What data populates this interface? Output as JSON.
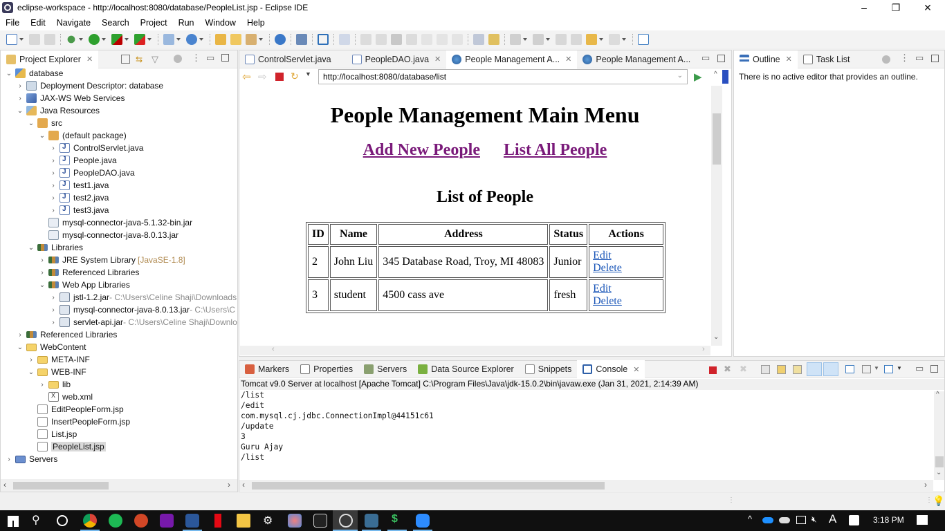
{
  "window": {
    "title": "eclipse-workspace - http://localhost:8080/database/PeopleList.jsp - Eclipse IDE",
    "minimize": "–",
    "restore": "❐",
    "close": "✕"
  },
  "menu": [
    "File",
    "Edit",
    "Navigate",
    "Search",
    "Project",
    "Run",
    "Window",
    "Help"
  ],
  "project_explorer": {
    "title": "Project Explorer",
    "tree": [
      {
        "label": "database",
        "twisty": "open",
        "icon": "project-icon",
        "depth": 0
      },
      {
        "label": "Deployment Descriptor: database",
        "twisty": "closed",
        "icon": "deployment-descriptor-icon",
        "depth": 1
      },
      {
        "label": "JAX-WS Web Services",
        "twisty": "closed",
        "icon": "web-services-icon",
        "depth": 1
      },
      {
        "label": "Java Resources",
        "twisty": "open",
        "icon": "java-resources-icon",
        "depth": 1
      },
      {
        "label": "src",
        "twisty": "open",
        "icon": "source-folder-icon",
        "depth": 2
      },
      {
        "label": "(default package)",
        "twisty": "open",
        "icon": "package-icon",
        "depth": 3
      },
      {
        "label": "ControlServlet.java",
        "twisty": "closed",
        "icon": "java-file-icon",
        "depth": 4
      },
      {
        "label": "People.java",
        "twisty": "closed",
        "icon": "java-file-icon",
        "depth": 4
      },
      {
        "label": "PeopleDAO.java",
        "twisty": "closed",
        "icon": "java-file-icon",
        "depth": 4
      },
      {
        "label": "test1.java",
        "twisty": "closed",
        "icon": "java-file-icon",
        "depth": 4
      },
      {
        "label": "test2.java",
        "twisty": "closed",
        "icon": "java-file-icon",
        "depth": 4
      },
      {
        "label": "test3.java",
        "twisty": "closed",
        "icon": "java-file-icon",
        "depth": 4
      },
      {
        "label": "mysql-connector-java-5.1.32-bin.jar",
        "twisty": "none",
        "icon": "jar-file-icon",
        "depth": 3
      },
      {
        "label": "mysql-connector-java-8.0.13.jar",
        "twisty": "none",
        "icon": "jar-file-icon",
        "depth": 3
      },
      {
        "label": "Libraries",
        "twisty": "open",
        "icon": "library-icon",
        "depth": 2
      },
      {
        "label": "JRE System Library",
        "decoration": "[JavaSE-1.8]",
        "twisty": "closed",
        "icon": "library-icon",
        "depth": 3
      },
      {
        "label": "Referenced Libraries",
        "twisty": "closed",
        "icon": "library-icon",
        "depth": 3
      },
      {
        "label": "Web App Libraries",
        "twisty": "open",
        "icon": "library-icon",
        "depth": 3
      },
      {
        "label": "jstl-1.2.jar",
        "decoration": " - C:\\Users\\Celine Shaji\\Downloads",
        "twisty": "closed",
        "icon": "jar-archive-icon",
        "depth": 4
      },
      {
        "label": "mysql-connector-java-8.0.13.jar",
        "decoration": " - C:\\Users\\C",
        "twisty": "closed",
        "icon": "jar-archive-icon",
        "depth": 4
      },
      {
        "label": "servlet-api.jar",
        "decoration": " - C:\\Users\\Celine Shaji\\Downlo",
        "twisty": "closed",
        "icon": "jar-archive-icon",
        "depth": 4
      },
      {
        "label": "Referenced Libraries",
        "twisty": "closed",
        "icon": "library-icon",
        "depth": 1
      },
      {
        "label": "WebContent",
        "twisty": "open",
        "icon": "folder-icon",
        "depth": 1
      },
      {
        "label": "META-INF",
        "twisty": "closed",
        "icon": "folder-icon",
        "depth": 2
      },
      {
        "label": "WEB-INF",
        "twisty": "open",
        "icon": "folder-icon",
        "depth": 2
      },
      {
        "label": "lib",
        "twisty": "closed",
        "icon": "folder-icon",
        "depth": 3
      },
      {
        "label": "web.xml",
        "twisty": "none",
        "icon": "xml-file-icon",
        "depth": 3
      },
      {
        "label": "EditPeopleForm.jsp",
        "twisty": "none",
        "icon": "jsp-file-icon",
        "depth": 2
      },
      {
        "label": "InsertPeopleForm.jsp",
        "twisty": "none",
        "icon": "jsp-file-icon",
        "depth": 2
      },
      {
        "label": "List.jsp",
        "twisty": "none",
        "icon": "jsp-file-icon",
        "depth": 2
      },
      {
        "label": "PeopleList.jsp",
        "twisty": "none",
        "icon": "jsp-file-icon",
        "depth": 2,
        "selected": true
      },
      {
        "label": "Servers",
        "twisty": "closed",
        "icon": "servers-folder-icon",
        "depth": 0
      }
    ]
  },
  "editor": {
    "tabs": [
      {
        "label": "ControlServlet.java",
        "icon": "java-file-icon",
        "active": false,
        "closable": false
      },
      {
        "label": "PeopleDAO.java",
        "icon": "java-file-icon",
        "active": false,
        "closable": true
      },
      {
        "label": "People Management A...",
        "icon": "globe-icon",
        "active": true,
        "closable": true
      },
      {
        "label": "People Management A...",
        "icon": "globe-icon",
        "active": false,
        "closable": false
      }
    ],
    "url": "http://localhost:8080/database/list"
  },
  "page": {
    "heading": "People Management Main Menu",
    "links": [
      "Add New People",
      "List All People"
    ],
    "subheading": "List of People",
    "table": {
      "columns": [
        "ID",
        "Name",
        "Address",
        "Status",
        "Actions"
      ],
      "rows": [
        {
          "id": "2",
          "name": "John Liu",
          "address": "345 Database Road, Troy, MI 48083",
          "status": "Junior",
          "edit": "Edit",
          "delete": "Delete"
        },
        {
          "id": "3",
          "name": "student",
          "address": "4500 cass ave",
          "status": "fresh",
          "edit": "Edit",
          "delete": "Delete"
        }
      ]
    }
  },
  "outline": {
    "tabs": [
      "Outline",
      "Task List"
    ],
    "message": "There is no active editor that provides an outline."
  },
  "bottom": {
    "tabs": [
      "Markers",
      "Properties",
      "Servers",
      "Data Source Explorer",
      "Snippets",
      "Console"
    ],
    "console_header": "Tomcat v9.0 Server at localhost [Apache Tomcat] C:\\Program Files\\Java\\jdk-15.0.2\\bin\\javaw.exe  (Jan 31, 2021, 2:14:39 AM)",
    "console_lines": [
      "/list",
      "/edit",
      "com.mysql.cj.jdbc.ConnectionImpl@44151c61",
      "/update",
      "3",
      "Guru Ajay",
      "/list"
    ]
  },
  "taskbar": {
    "clock": "3:18 PM",
    "apps": [
      "start",
      "search",
      "cortana",
      "chrome",
      "spotify",
      "powerpoint",
      "onenote",
      "word",
      "netflix",
      "file-explorer",
      "settings",
      "paint",
      "command-prompt",
      "eclipse",
      "mysql-workbench",
      "app-s",
      "zoom"
    ]
  }
}
